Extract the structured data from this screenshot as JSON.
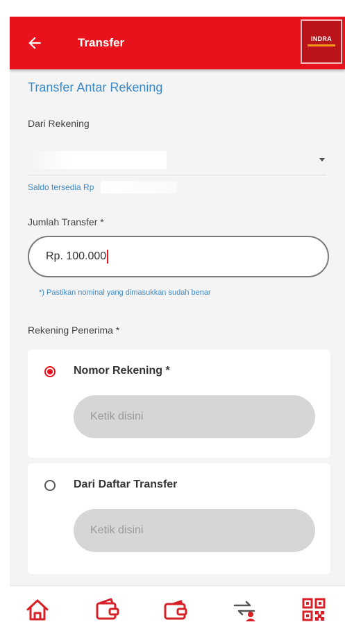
{
  "header": {
    "title": "Transfer",
    "logo_text": "INDRA",
    "logo_subtext": ""
  },
  "form": {
    "section_title": "Transfer Antar Rekening",
    "from_label": "Dari Rekening",
    "from_value": "",
    "saldo_label": "Saldo tersedia Rp",
    "amount_label": "Jumlah Transfer *",
    "amount_value": "Rp. 100.000",
    "amount_hint": "*) Pastikan nominal yang dimasukkan sudah benar",
    "recipient_label": "Rekening Penerima *",
    "options": [
      {
        "label": "Nomor Rekening *",
        "selected": true,
        "placeholder": "Ketik disini"
      },
      {
        "label": "Dari Daftar Transfer",
        "selected": false,
        "placeholder": "Ketik disini"
      }
    ]
  },
  "bottom_nav": {
    "items": [
      {
        "icon": "home-icon",
        "label": ""
      },
      {
        "icon": "wallet-icon",
        "label": ""
      },
      {
        "icon": "wallet-card-icon",
        "label": ""
      },
      {
        "icon": "transfer-icon",
        "label": ""
      },
      {
        "icon": "qr-code-icon",
        "label": ""
      }
    ]
  },
  "colors": {
    "primary": "#e8111c",
    "link": "#3b89c9",
    "icon": "#d61f26"
  }
}
